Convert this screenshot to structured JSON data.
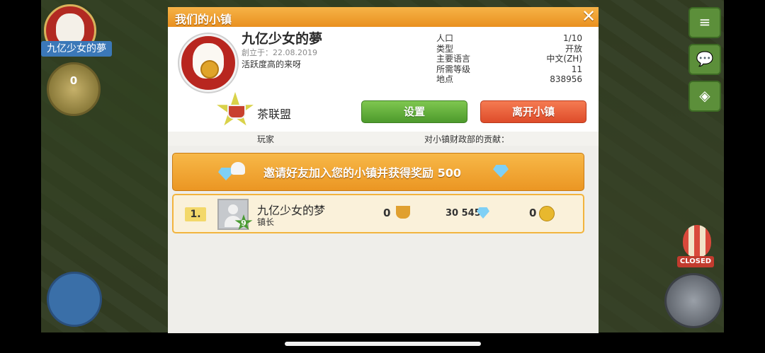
{
  "dialog": {
    "title": "我们的小镇",
    "close_label": "✕"
  },
  "town": {
    "name": "九亿少女的夢",
    "founded": "創立于：22.08.2019",
    "description": "活跃度高的来呀",
    "stats": [
      {
        "label": "人口",
        "value": "1/10"
      },
      {
        "label": "类型",
        "value": "开放"
      },
      {
        "label": "主要语言",
        "value": "中文(ZH)"
      },
      {
        "label": "所需等级",
        "value": "11"
      },
      {
        "label": "地点",
        "value": "838956"
      }
    ],
    "alliance": "茶联盟"
  },
  "buttons": {
    "settings": "设置",
    "leave": "离开小镇"
  },
  "columns": {
    "player": "玩家",
    "contribution": "对小镇财政部的贡献："
  },
  "invite": {
    "text": "邀请好友加入您的小镇并获得奖励 500"
  },
  "members": [
    {
      "rank": "1.",
      "level": "9",
      "name": "九亿少女的梦",
      "role": "镇长",
      "trophies": "0",
      "gems": "30 545",
      "coins": "0"
    }
  ],
  "hud": {
    "player_name": "九亿少女的夢",
    "medal_count": "0",
    "closed_sign": "CLOSED",
    "menu_icon": "≡",
    "chat_icon": "💬"
  }
}
